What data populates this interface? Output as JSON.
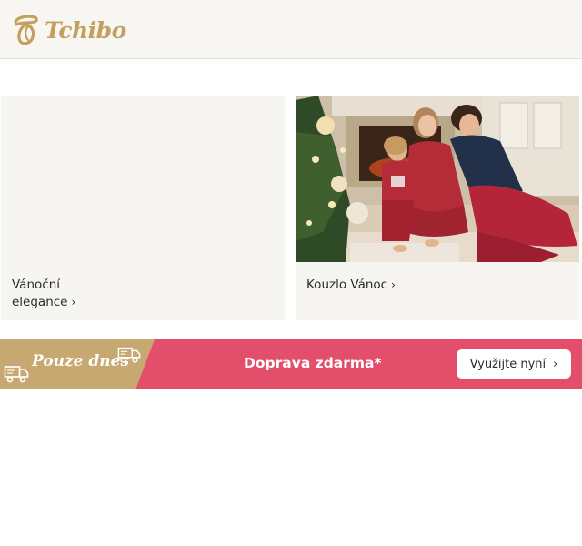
{
  "header": {
    "brand": "Tchibo"
  },
  "cards": [
    {
      "lines": [
        "Vánoční",
        "elegance"
      ]
    },
    {
      "lines": [
        "Kouzlo Vánoc"
      ]
    }
  ],
  "banner": {
    "tag": "Pouze dnes",
    "text": "Doprava zdarma*",
    "cta": "Využijte nyní"
  },
  "icons": {
    "chevron": "chevron-right-icon",
    "truck": "truck-icon"
  },
  "colors": {
    "brand_gold": "#c4a05e",
    "banner_pink": "#e34f6b",
    "banner_gold": "#c6a870",
    "header_bg": "#f8f6f2",
    "card_bg": "#f7f5f1"
  }
}
